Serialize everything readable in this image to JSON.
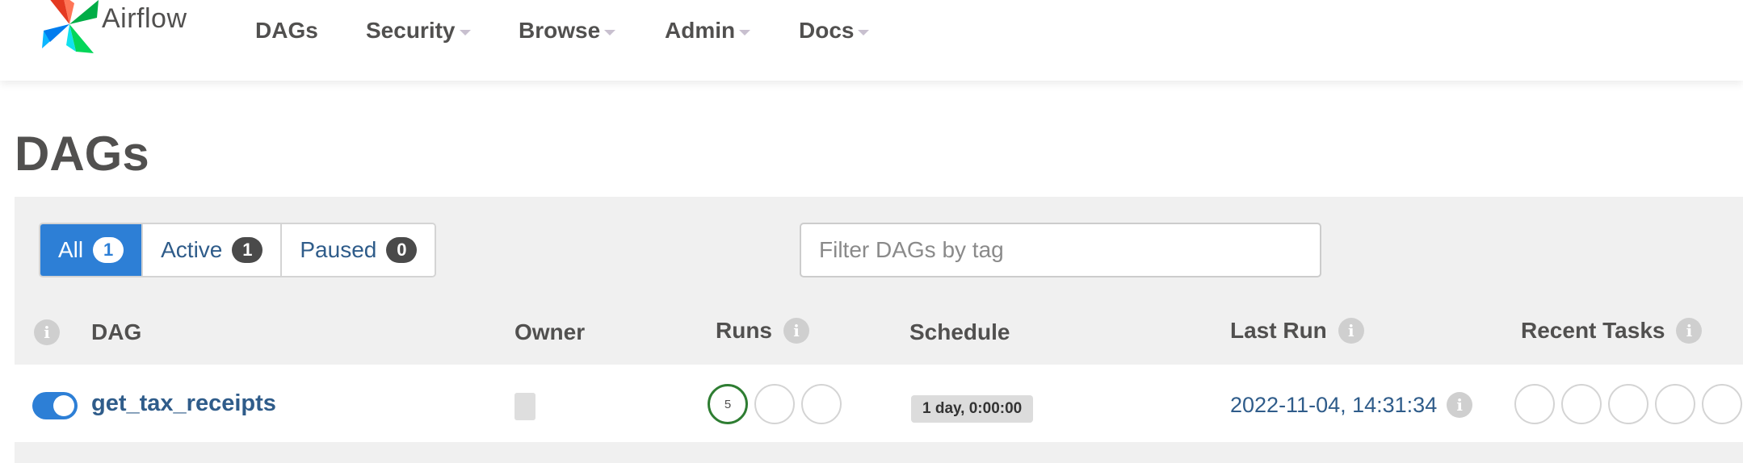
{
  "brand": {
    "name": "Airflow"
  },
  "nav": {
    "items": [
      {
        "label": "DAGs",
        "dropdown": false
      },
      {
        "label": "Security",
        "dropdown": true
      },
      {
        "label": "Browse",
        "dropdown": true
      },
      {
        "label": "Admin",
        "dropdown": true
      },
      {
        "label": "Docs",
        "dropdown": true
      }
    ]
  },
  "page": {
    "title": "DAGs"
  },
  "filters": {
    "all": {
      "label": "All",
      "count": "1",
      "active": true
    },
    "active": {
      "label": "Active",
      "count": "1"
    },
    "paused": {
      "label": "Paused",
      "count": "0"
    },
    "tag_placeholder": "Filter DAGs by tag"
  },
  "table": {
    "headers": {
      "dag": "DAG",
      "owner": "Owner",
      "runs": "Runs",
      "schedule": "Schedule",
      "last_run": "Last Run",
      "recent_tasks": "Recent Tasks"
    },
    "rows": [
      {
        "enabled": true,
        "dag_id": "get_tax_receipts",
        "owner": "",
        "runs": [
          {
            "state": "success",
            "count": "5"
          },
          {
            "state": "empty",
            "count": ""
          },
          {
            "state": "empty",
            "count": ""
          }
        ],
        "schedule": "1 day, 0:00:00",
        "last_run": "2022-11-04, 14:31:34",
        "recent_tasks_count": 5
      }
    ]
  },
  "colors": {
    "primary": "#2d7fd6",
    "link": "#2f5c8a",
    "success": "#2e7d32",
    "text": "#51504f",
    "panel_bg": "#f0f0f0"
  },
  "icons": {
    "info": "info-icon",
    "caret": "caret-down-icon",
    "logo": "airflow-pinwheel-logo"
  }
}
